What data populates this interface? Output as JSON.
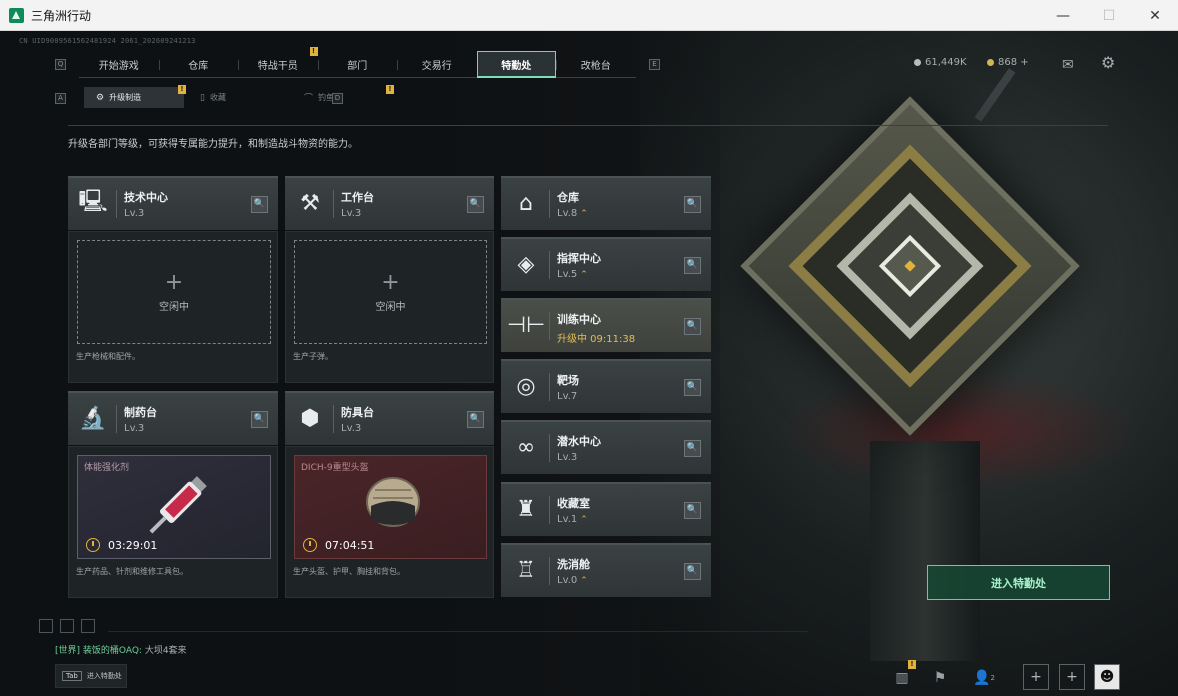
{
  "window": {
    "title": "三角洲行动",
    "minimize": "—",
    "maximize": "☐",
    "close": "✕"
  },
  "uid": "CN UID9009561562481924 2061_202609241213",
  "nav": {
    "left_key": "Q",
    "right_key": "E",
    "items": [
      {
        "label": "开始游戏",
        "badge": ""
      },
      {
        "label": "仓库",
        "badge": ""
      },
      {
        "label": "特战干员",
        "badge": "!"
      },
      {
        "label": "部门",
        "badge": ""
      },
      {
        "label": "交易行",
        "badge": ""
      },
      {
        "label": "特勤处",
        "badge": "",
        "active": true
      },
      {
        "label": "改枪台",
        "badge": ""
      }
    ]
  },
  "subnav": {
    "left_key": "A",
    "right_key": "D",
    "items": [
      {
        "label": "升级制造",
        "icon": "⚙",
        "active": true
      },
      {
        "label": "收藏",
        "icon": "▯"
      },
      {
        "label": "钓鱼",
        "icon": "⌒"
      }
    ]
  },
  "description": "升级各部门等级，可获得专属能力提升，和制造战斗物资的能力。",
  "workshops": [
    {
      "name": "技术中心",
      "level": "Lv.3",
      "icon": "computer-icon",
      "glyph": "🖳",
      "state": "空闲中",
      "footer": "生产枪械和配件。"
    },
    {
      "name": "工作台",
      "level": "Lv.3",
      "icon": "tools-icon",
      "glyph": "⚒",
      "state": "空闲中",
      "footer": "生产子弹。"
    },
    {
      "name": "制药台",
      "level": "Lv.3",
      "icon": "microscope-icon",
      "glyph": "🔬",
      "item": "体能强化剂",
      "timer": "03:29:01",
      "footer": "生产药品、针剂和维修工具包。"
    },
    {
      "name": "防具台",
      "level": "Lv.3",
      "icon": "cubes-icon",
      "glyph": "⬢",
      "item": "DICH-9重型头盔",
      "timer": "07:04:51",
      "footer": "生产头盔、护甲、胸挂和背包。"
    }
  ],
  "facilities": [
    {
      "name": "仓库",
      "level": "Lv.8",
      "icon": "warehouse-icon",
      "glyph": "⌂",
      "upgradable": true
    },
    {
      "name": "指挥中心",
      "level": "Lv.5",
      "icon": "chip-icon",
      "glyph": "◈",
      "upgradable": true
    },
    {
      "name": "训练中心",
      "level": "升级中 09:11:38",
      "icon": "dumbbell-icon",
      "glyph": "⊣⊢",
      "upgrading": true
    },
    {
      "name": "靶场",
      "level": "Lv.7",
      "icon": "target-icon",
      "glyph": "◎"
    },
    {
      "name": "潜水中心",
      "level": "Lv.3",
      "icon": "goggles-icon",
      "glyph": "∞"
    },
    {
      "name": "收藏室",
      "level": "Lv.1",
      "icon": "trophy-icon",
      "glyph": "♜",
      "upgradable": true
    },
    {
      "name": "洗消舱",
      "level": "Lv.0",
      "icon": "hazmat-icon",
      "glyph": "♖",
      "upgradable": true
    }
  ],
  "search_glyph": "🔍",
  "upgrade_glyph": "⌃",
  "currency": [
    {
      "value": "61,449K",
      "color": "#b8bcbe"
    },
    {
      "value": "868 +",
      "color": "#d4b45a"
    }
  ],
  "enter_button": "进入特勤处",
  "chat": {
    "channel": "[世界]",
    "user": "装饭的桶OAQ:",
    "message": "大坝4套来"
  },
  "tab_hint": {
    "key": "Tab",
    "label": "进入特勤处"
  },
  "bottom_badge_count": "2"
}
